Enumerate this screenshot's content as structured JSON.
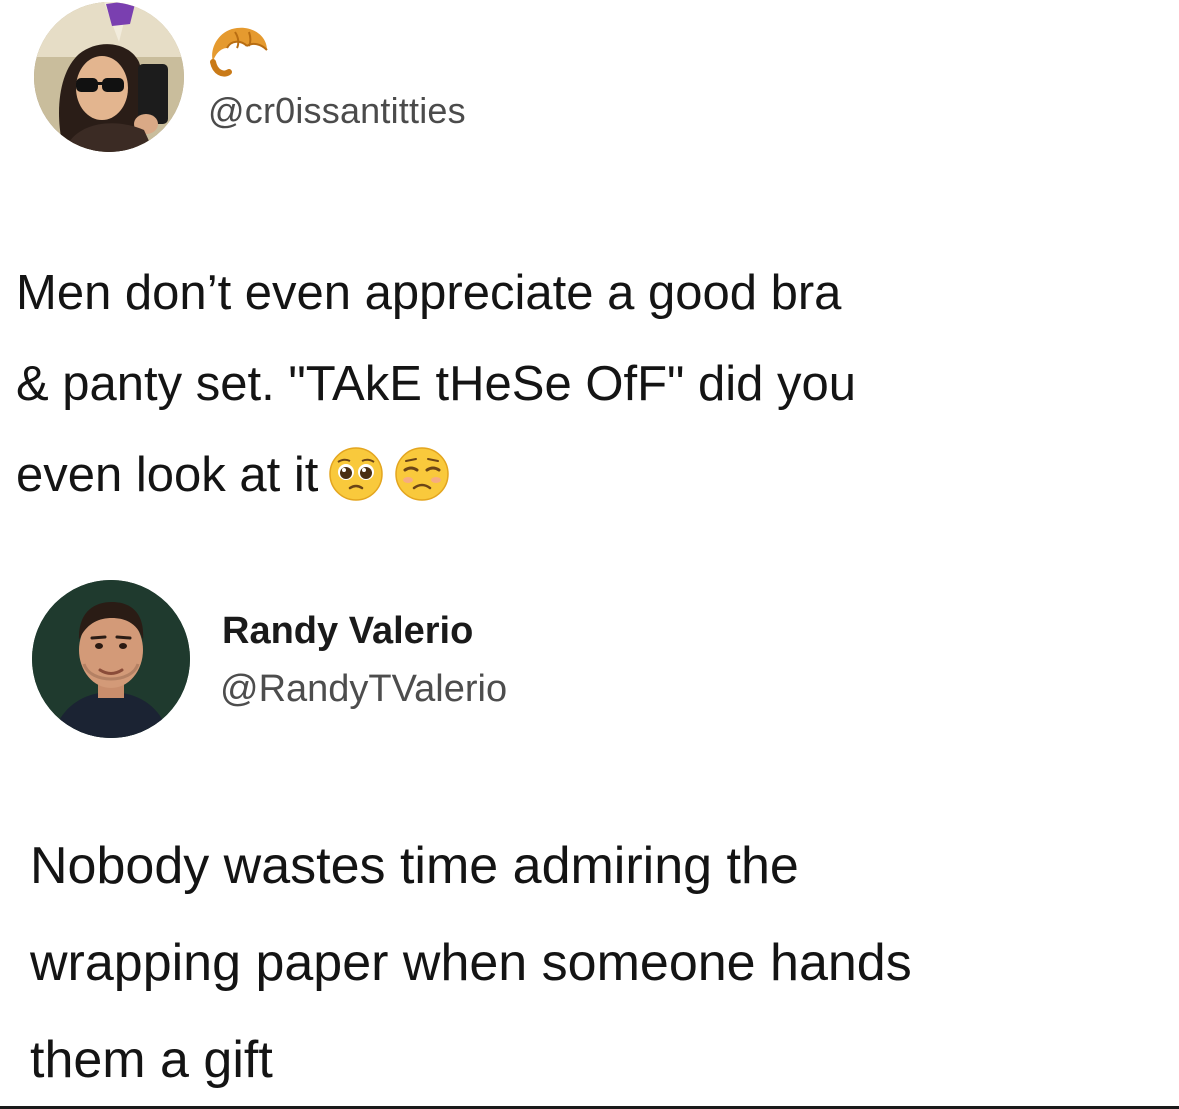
{
  "tweet1": {
    "avatar_icon": "profile-photo-woman-sunglasses",
    "badge_icon": "croissant-icon",
    "handle": "@cr0issantitties",
    "text_lines": [
      "Men don’t even appreciate a good bra",
      "& panty set. \"TAkE tHeSe OfF\" did you",
      "even look at it"
    ],
    "emojis": [
      "pleading-face-icon",
      "unamused-face-icon"
    ]
  },
  "tweet2": {
    "avatar_icon": "profile-photo-man",
    "name": "Randy Valerio",
    "handle": "@RandyTValerio",
    "text_lines": [
      "Nobody wastes time admiring the",
      "wrapping paper when someone hands",
      "them a gift"
    ]
  }
}
